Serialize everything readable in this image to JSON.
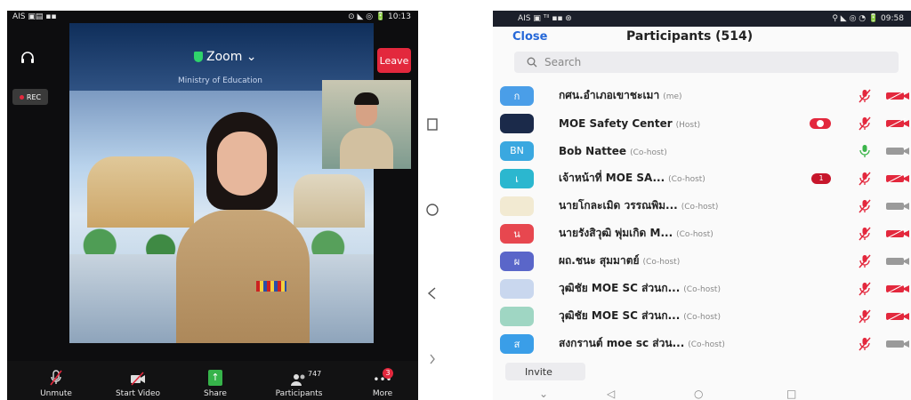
{
  "meeting": {
    "status_left": "AIS ▣▤ ▪▪",
    "status_right": "⊙ ◣ ◎ 🔋 10:13",
    "title": "Zoom ⌄",
    "leave_label": "Leave",
    "rec_label": "REC",
    "ministry_text": "Ministry of Education",
    "participant_count": "747",
    "more_badge": "3",
    "toolbar": {
      "unmute": "Unmute",
      "start_video": "Start Video",
      "share": "Share",
      "participants": "Participants",
      "more": "More"
    }
  },
  "participants_panel": {
    "status_left": "AIS ▣ ᵀᴵˡ ▪▪ ⊛",
    "status_right": "⚲ ◣ ◎ ◔ 🔋 09:58",
    "close_label": "Close",
    "title": "Participants (514)",
    "search_placeholder": "Search",
    "invite_label": "Invite",
    "rows": [
      {
        "avatar": "ก",
        "avatar_color": "#4a9ee8",
        "name": "กศน.อำเภอเขาชะเมา",
        "role": "(me)",
        "mic": "muted",
        "cam": "off"
      },
      {
        "avatar": "",
        "avatar_color": "#1b2a4a",
        "name": "MOE Safety Center",
        "role": "(Host)",
        "mic": "muted",
        "cam": "off",
        "recording": true
      },
      {
        "avatar": "BN",
        "avatar_color": "#3aa8e0",
        "name": "Bob Nattee",
        "role": "(Co-host)",
        "mic": "on",
        "cam": "on"
      },
      {
        "avatar": "เ",
        "avatar_color": "#2bb7cf",
        "name": "เจ้าหน้าที่ MOE SA...",
        "role": "(Co-host)",
        "mic": "muted",
        "cam": "off",
        "chat_badge": "1"
      },
      {
        "avatar": "",
        "avatar_color": "#f2ead2",
        "name": "นายโกละเมิด วรรณพิม...",
        "role": "(Co-host)",
        "mic": "muted",
        "cam": "on"
      },
      {
        "avatar": "น",
        "avatar_color": "#e7474f",
        "name": "นายรังสิวุฒิ พุ่มเกิด M...",
        "role": "(Co-host)",
        "mic": "muted",
        "cam": "off"
      },
      {
        "avatar": "ผ",
        "avatar_color": "#5a66c9",
        "name": "ผถ.ชนะ สุมมาตย์",
        "role": "(Co-host)",
        "mic": "muted",
        "cam": "on"
      },
      {
        "avatar": "",
        "avatar_color": "#c9d7ee",
        "name": "วุฒิชัย MOE SC ส่วนก...",
        "role": "(Co-host)",
        "mic": "muted",
        "cam": "off"
      },
      {
        "avatar": "",
        "avatar_color": "#9fd6c3",
        "name": "วุฒิชัย MOE SC ส่วนก...",
        "role": "(Co-host)",
        "mic": "muted",
        "cam": "off"
      },
      {
        "avatar": "ส",
        "avatar_color": "#3a9ee8",
        "name": "สงกรานต์ moe sc ส่วน...",
        "role": "(Co-host)",
        "mic": "muted",
        "cam": "on"
      }
    ]
  },
  "colors": {
    "zoom_red": "#e3283d",
    "link_blue": "#2668d8",
    "muted_mic": "#e3283d",
    "cam_off": "#e3283d"
  }
}
